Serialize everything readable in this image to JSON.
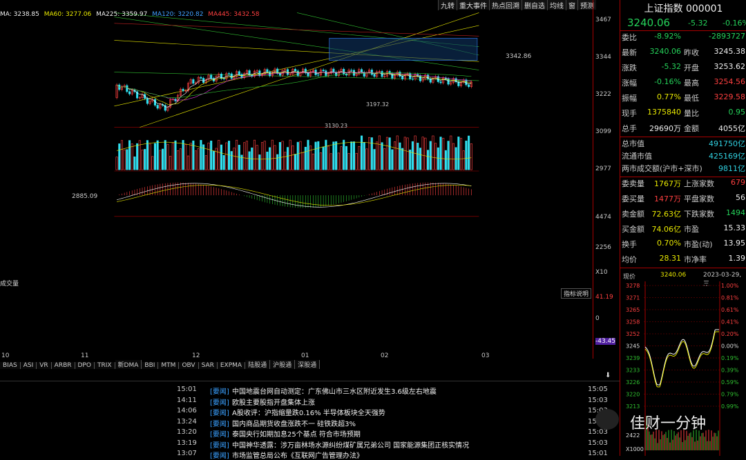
{
  "toolbar": [
    "九转",
    "重大事件",
    "热点回溯",
    "删自选",
    "均线",
    "窗",
    "预测"
  ],
  "ma_legend": {
    "ma": "MA: 3238.85",
    "ma60": "MA60: 3277.06",
    "ma225": "MA225: 3359.97",
    "ma120": "MA120: 3220.82",
    "ma445": "MA445: 3432.58"
  },
  "price_axis": [
    "3467",
    "3344",
    "3222",
    "3099",
    "2977"
  ],
  "volume_axis": [
    "4474",
    "2256",
    "X10"
  ],
  "macd_axis": [
    "41.19",
    "0",
    "-43.45"
  ],
  "macd_label": "指标说明",
  "volume_label": "成交量",
  "annotations": {
    "high": "3342.86",
    "low": "2885.09",
    "mid1": "3197.32",
    "mid2": "3130.23"
  },
  "month_labels": [
    "10",
    "11",
    "12",
    "01",
    "02",
    "03"
  ],
  "indicator_tabs": [
    "BIAS",
    "ASI",
    "VR",
    "ARBR",
    "DPO",
    "TRIX",
    "新DMA",
    "BBI",
    "MTM",
    "OBV",
    "SAR",
    "EXPMA",
    "陆股通",
    "沪股通",
    "深股通"
  ],
  "quote": {
    "title": "上证指数 000001",
    "price": "3240.06",
    "change": "-5.32",
    "pct": "-0.16%",
    "rows": [
      {
        "k": "委比",
        "v": "-8.92%",
        "k2": "",
        "v2": "-2893727"
      },
      {
        "k": "最新",
        "v": "3240.06",
        "k2": "昨收",
        "v2": "3245.38"
      },
      {
        "k": "涨跌",
        "v": "-5.32",
        "k2": "开盘",
        "v2": "3253.62"
      },
      {
        "k": "涨幅",
        "v": "-0.16%",
        "k2": "最高",
        "v2": "3254.56"
      },
      {
        "k": "振幅",
        "v": "0.77%",
        "k2": "最低",
        "v2": "3229.58"
      },
      {
        "k": "现手",
        "v": "1375840",
        "k2": "量比",
        "v2": "0.95"
      },
      {
        "k": "总手",
        "v": "29690万",
        "k2": "金额",
        "v2": "4055亿"
      },
      {
        "k": "总市值",
        "v": "",
        "k2": "",
        "v2": "491750亿"
      },
      {
        "k": "流通市值",
        "v": "",
        "k2": "",
        "v2": "425169亿"
      },
      {
        "k": "两市成交额(沪市+深市)",
        "v": "",
        "k2": "",
        "v2": "9811亿"
      },
      {
        "k": "委卖量",
        "v": "1767万",
        "k2": "上涨家数",
        "v2": "679"
      },
      {
        "k": "委买量",
        "v": "1477万",
        "k2": "平盘家数",
        "v2": "56"
      },
      {
        "k": "卖金额",
        "v": "72.63亿",
        "k2": "下跌家数",
        "v2": "1494"
      },
      {
        "k": "买金额",
        "v": "74.06亿",
        "k2": "市盈",
        "v2": "15.33"
      },
      {
        "k": "换手",
        "v": "0.70%",
        "k2": "市盈(动)",
        "v2": "13.95"
      },
      {
        "k": "均价",
        "v": "28.31",
        "k2": "市净率",
        "v2": "1.39"
      }
    ]
  },
  "intraday": {
    "label": "现价",
    "price": "3240.06",
    "date": "2023-03-29,三",
    "left_axis": [
      "3278",
      "3271",
      "3265",
      "3258",
      "3252",
      "3245",
      "3239",
      "3233",
      "3226",
      "3220",
      "3213"
    ],
    "right_axis": [
      "1.00%",
      "0.81%",
      "0.61%",
      "0.41%",
      "0.20%",
      "0.00%",
      "0.19%",
      "0.39%",
      "0.59%",
      "0.79%",
      "0.99%"
    ],
    "vol_axis": [
      "2422",
      "X1000"
    ]
  },
  "news": [
    {
      "time": "15:01",
      "tag": "[要闻]",
      "headline": "中国地震台网自动测定：广东佛山市三水区附近发生3.6级左右地震",
      "time2": "15:05"
    },
    {
      "time": "14:11",
      "tag": "[要闻]",
      "headline": "欧股主要股指开盘集体上涨",
      "time2": "15:03"
    },
    {
      "time": "14:06",
      "tag": "[要闻]",
      "headline": "A股收评：沪指缩量跌0.16% 半导体板块全天强势",
      "time2": "15:03"
    },
    {
      "time": "13:24",
      "tag": "[要闻]",
      "headline": "国内商品期货收盘涨跌不一 硅铁跌超3%",
      "time2": "15:03"
    },
    {
      "time": "13:20",
      "tag": "[要闻]",
      "headline": "泰国央行如期加息25个基点 符合市场预期",
      "time2": "15:03"
    },
    {
      "time": "13:19",
      "tag": "[要闻]",
      "headline": "中国神华透露：涉万亩林场水源纠纷煤矿属兄弟公司 国家能源集团正核实情况",
      "time2": "15:03"
    },
    {
      "time": "13:07",
      "tag": "[要闻]",
      "headline": "市场监管总局公布《互联网广告管理办法》",
      "time2": "15:01"
    }
  ],
  "watermark": "佳财一分钟",
  "colors": {
    "up": "#ff4040",
    "down": "#30e0f0",
    "ma_white": "#ffffff",
    "ma_yellow": "#e8e800",
    "ma_magenta": "#e040e0",
    "ma_green": "#30c030",
    "border": "#aa0000"
  }
}
